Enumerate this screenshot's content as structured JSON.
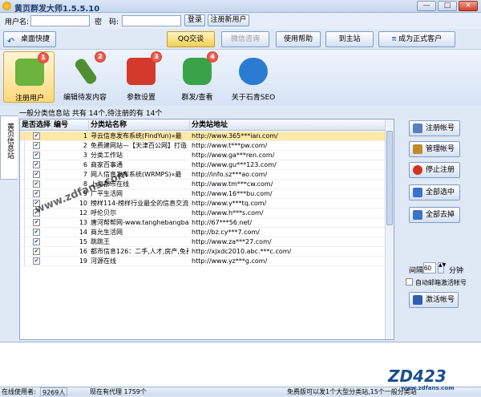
{
  "window": {
    "title": "黄页群发大师1.5.5.10",
    "min": "—",
    "max": "□",
    "close": "×"
  },
  "login": {
    "user_label": "用户名:",
    "pass_label": "密　码:",
    "user_value": "",
    "pass_value": "",
    "login_btn": "登录",
    "register_btn": "注册新用户"
  },
  "toolbar": {
    "home": "桌面快捷",
    "qq": "QQ交谈",
    "wechat": "微信咨询",
    "help": "使用帮助",
    "site": "到主站",
    "vip": "成为正式客户"
  },
  "tabs": [
    {
      "label": "注册用户",
      "badge": "1",
      "color": "#6cb33f"
    },
    {
      "label": "编辑待发内容",
      "badge": "2",
      "color": "#4f8f2f"
    },
    {
      "label": "参数设置",
      "badge": "3",
      "color": "#d33a2c"
    },
    {
      "label": "群发/查看",
      "badge": "4",
      "color": "#3aa34a"
    },
    {
      "label": "关于石青SEO",
      "badge": "",
      "color": "#2a7bd1"
    }
  ],
  "side_tab": "黄页信息站",
  "summary": "一般分类信息站 共有 14个,待注册的有 14个",
  "columns": [
    "是否选择",
    "编号",
    "分类站名称",
    "分类站地址"
  ],
  "rows": [
    {
      "n": "1",
      "name": "寻云信息发布系统(FindYun)«最",
      "url": "http://www.365***ian.com/"
    },
    {
      "n": "2",
      "name": "免费建网站—【天津百公网】打造",
      "url": "http://www.t***pw.com/"
    },
    {
      "n": "3",
      "name": "分类工作站",
      "url": "http://www.ga***ren.com/"
    },
    {
      "n": "6",
      "name": "商家百事通",
      "url": "http://www.gu***123.com/"
    },
    {
      "n": "7",
      "name": "网人信息发布系统(WRMPS)«最",
      "url": "http://info.sz***ao.com/"
    },
    {
      "n": "8",
      "name": "上海都市在线",
      "url": "http://www.tm***cw.com/"
    },
    {
      "n": "9",
      "name": "广平生活网",
      "url": "http://www.16***bu.com/"
    },
    {
      "n": "10",
      "name": "榜样114-榜样行业最全的信息交流",
      "url": "http://www.y***tq.com/"
    },
    {
      "n": "12",
      "name": "呼伦贝尔",
      "url": "http://www.h***s.com/"
    },
    {
      "n": "13",
      "name": "唐河帮帮网-www.tanghebangbang",
      "url": "http://67***56.net/"
    },
    {
      "n": "14",
      "name": "商允生活网",
      "url": "http://bz.cy***7.com/"
    },
    {
      "n": "15",
      "name": "跳跳王",
      "url": "http://www.za***27.com/"
    },
    {
      "n": "16",
      "name": "都市信息126：二手,人才,房产,免费",
      "url": "http://xjxdc2010.abc.***c.com/"
    },
    {
      "n": "19",
      "name": "河源在线",
      "url": "http://www.yz***g.com/"
    }
  ],
  "right": {
    "register": "注册帐号",
    "manage": "管理帐号",
    "stop": "停止注册",
    "select_all": "全部选中",
    "deselect_all": "全部去掉",
    "interval_label": "间隔",
    "interval_value": "60",
    "minutes": "分钟",
    "auto_mail": "自动邮箱激活帐号",
    "activate": "激活帐号"
  },
  "status": {
    "online_label": "在线使用者:",
    "online_value": "9269人",
    "proxy": "现在有代理 1759个",
    "notice": "免费版可以发1个大型分类站,15个一般分类站"
  },
  "watermarks": {
    "left": "www.zdfans.com",
    "right_big": "ZD423",
    "right_small": "www.zdfans.com"
  }
}
